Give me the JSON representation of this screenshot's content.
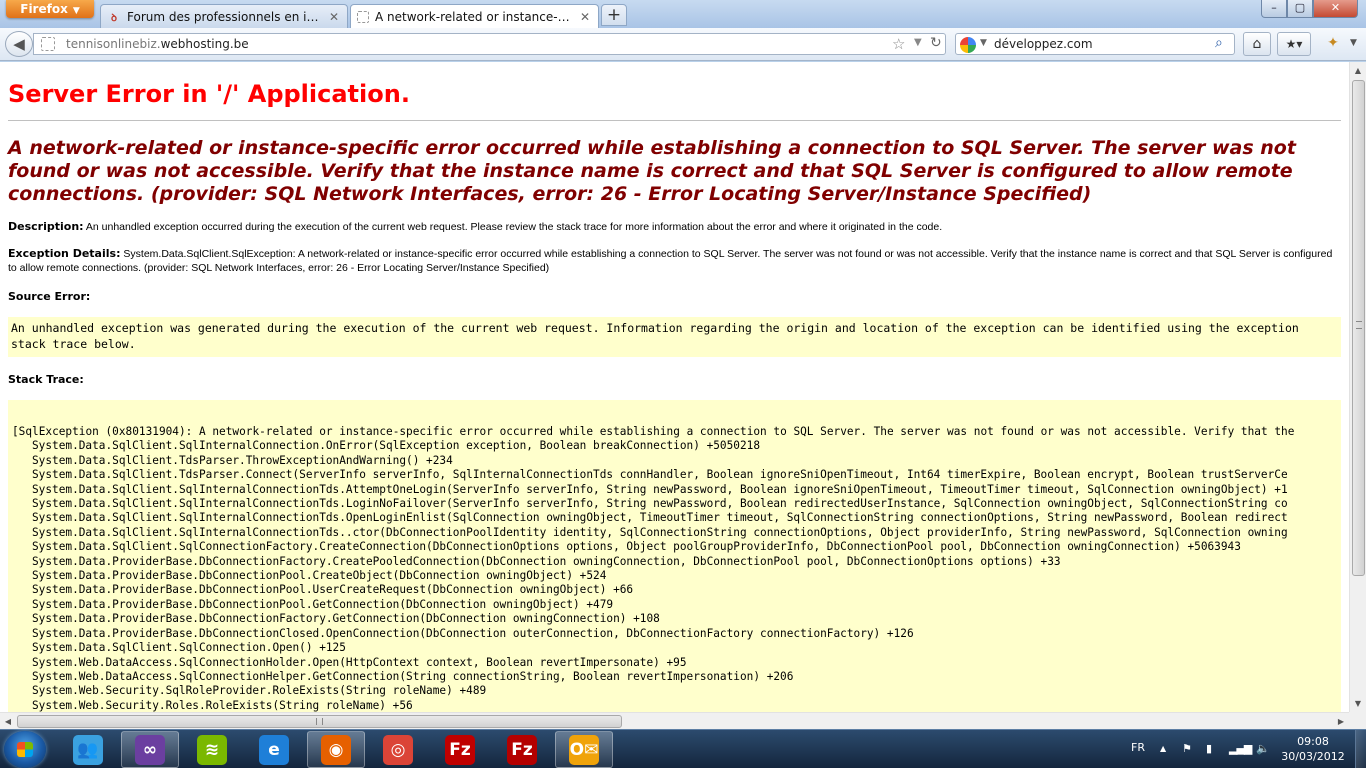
{
  "browser": {
    "menu_button": "Firefox",
    "tabs": [
      {
        "title": "Forum des professionnels en informa...",
        "favicon": "developpez-icon"
      },
      {
        "title": "A network-related or instance-specifi...",
        "favicon": "blank-page-icon"
      }
    ],
    "new_tab": "+",
    "window_controls": {
      "minimize": "–",
      "maximize": "▢",
      "close": "✕"
    },
    "url": {
      "prefix": "tennisonlinebiz.",
      "domain": "webhosting.be"
    },
    "search": {
      "value": "développez.com",
      "engine_icon": "google-icon"
    }
  },
  "page": {
    "title": "Server Error in '/' Application.",
    "error_message": "A network-related or instance-specific error occurred while establishing a connection to SQL Server. The server was not found or was not accessible. Verify that the instance name is correct and that SQL Server is configured to allow remote connections. (provider: SQL Network Interfaces, error: 26 - Error Locating Server/Instance Specified)",
    "description_label": "Description:",
    "description_text": "An unhandled exception occurred during the execution of the current web request. Please review the stack trace for more information about the error and where it originated in the code.",
    "exception_label": "Exception Details:",
    "exception_text": "System.Data.SqlClient.SqlException: A network-related or instance-specific error occurred while establishing a connection to SQL Server. The server was not found or was not accessible. Verify that the instance name is correct and that SQL Server is configured to allow remote connections. (provider: SQL Network Interfaces, error: 26 - Error Locating Server/Instance Specified)",
    "source_error_label": "Source Error:",
    "source_error_text": "An unhandled exception was generated during the execution of the current web request. Information regarding the origin and location of the exception can be identified using the exception stack trace below.",
    "stack_trace_label": "Stack Trace:",
    "stack_trace_header": "[SqlException (0x80131904): A network-related or instance-specific error occurred while establishing a connection to SQL Server. The server was not found or was not accessible. Verify that the",
    "stack_trace_frames": [
      "System.Data.SqlClient.SqlInternalConnection.OnError(SqlException exception, Boolean breakConnection) +5050218",
      "System.Data.SqlClient.TdsParser.ThrowExceptionAndWarning() +234",
      "System.Data.SqlClient.TdsParser.Connect(ServerInfo serverInfo, SqlInternalConnectionTds connHandler, Boolean ignoreSniOpenTimeout, Int64 timerExpire, Boolean encrypt, Boolean trustServerCe",
      "System.Data.SqlClient.SqlInternalConnectionTds.AttemptOneLogin(ServerInfo serverInfo, String newPassword, Boolean ignoreSniOpenTimeout, TimeoutTimer timeout, SqlConnection owningObject) +1",
      "System.Data.SqlClient.SqlInternalConnectionTds.LoginNoFailover(ServerInfo serverInfo, String newPassword, Boolean redirectedUserInstance, SqlConnection owningObject, SqlConnectionString co",
      "System.Data.SqlClient.SqlInternalConnectionTds.OpenLoginEnlist(SqlConnection owningObject, TimeoutTimer timeout, SqlConnectionString connectionOptions, String newPassword, Boolean redirect",
      "System.Data.SqlClient.SqlInternalConnectionTds..ctor(DbConnectionPoolIdentity identity, SqlConnectionString connectionOptions, Object providerInfo, String newPassword, SqlConnection owning",
      "System.Data.SqlClient.SqlConnectionFactory.CreateConnection(DbConnectionOptions options, Object poolGroupProviderInfo, DbConnectionPool pool, DbConnection owningConnection) +5063943",
      "System.Data.ProviderBase.DbConnectionFactory.CreatePooledConnection(DbConnection owningConnection, DbConnectionPool pool, DbConnectionOptions options) +33",
      "System.Data.ProviderBase.DbConnectionPool.CreateObject(DbConnection owningObject) +524",
      "System.Data.ProviderBase.DbConnectionPool.UserCreateRequest(DbConnection owningObject) +66",
      "System.Data.ProviderBase.DbConnectionPool.GetConnection(DbConnection owningObject) +479",
      "System.Data.ProviderBase.DbConnectionFactory.GetConnection(DbConnection owningConnection) +108",
      "System.Data.ProviderBase.DbConnectionClosed.OpenConnection(DbConnection outerConnection, DbConnectionFactory connectionFactory) +126",
      "System.Data.SqlClient.SqlConnection.Open() +125",
      "System.Web.DataAccess.SqlConnectionHolder.Open(HttpContext context, Boolean revertImpersonate) +95",
      "System.Web.DataAccess.SqlConnectionHelper.GetConnection(String connectionString, Boolean revertImpersonation) +206",
      "System.Web.Security.SqlRoleProvider.RoleExists(String roleName) +489",
      "System.Web.Security.Roles.RoleExists(String roleName) +56"
    ]
  },
  "taskbar": {
    "apps": [
      {
        "name": "windows-live-messenger-icon",
        "color": "#3aa1e0",
        "glyph": "👥"
      },
      {
        "name": "visual-studio-icon",
        "color": "#6b3fa0",
        "glyph": "∞",
        "active": true
      },
      {
        "name": "spotify-icon",
        "color": "#7ab800",
        "glyph": "≋"
      },
      {
        "name": "internet-explorer-icon",
        "color": "#1e7fd8",
        "glyph": "e"
      },
      {
        "name": "firefox-icon",
        "color": "#e66000",
        "glyph": "◉",
        "active": true
      },
      {
        "name": "chrome-icon",
        "color": "#db4437",
        "glyph": "◎"
      },
      {
        "name": "filezilla-icon",
        "color": "#bf0000",
        "glyph": "Fz"
      },
      {
        "name": "filezilla-server-icon",
        "color": "#b40000",
        "glyph": "Fz"
      },
      {
        "name": "outlook-icon",
        "color": "#f0a30a",
        "glyph": "O✉",
        "active": true
      }
    ],
    "language": "FR",
    "time": "09:08",
    "date": "30/03/2012"
  }
}
